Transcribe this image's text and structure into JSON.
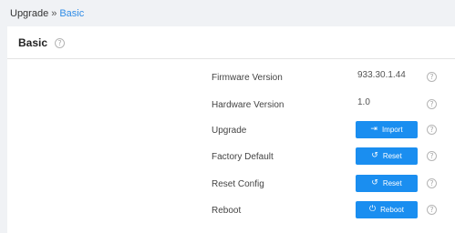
{
  "breadcrumb": {
    "root": "Upgrade",
    "separator": "»",
    "current": "Basic"
  },
  "section": {
    "title": "Basic",
    "help_icon": "?"
  },
  "rows": [
    {
      "label": "Firmware Version",
      "value": "933.30.1.44"
    },
    {
      "label": "Hardware Version",
      "value": "1.0"
    },
    {
      "label": "Upgrade",
      "button": "Import",
      "icon": "import-icon",
      "glyph": "⇥"
    },
    {
      "label": "Factory Default",
      "button": "Reset",
      "icon": "reset-icon",
      "glyph": "↺"
    },
    {
      "label": "Reset Config",
      "button": "Reset",
      "icon": "reset-icon",
      "glyph": "↺"
    },
    {
      "label": "Reboot",
      "button": "Reboot",
      "icon": "power-icon",
      "glyph": "⏻"
    }
  ],
  "colors": {
    "accent": "#1a8ef0",
    "link": "#2f8ce6",
    "background": "#f0f2f5"
  }
}
